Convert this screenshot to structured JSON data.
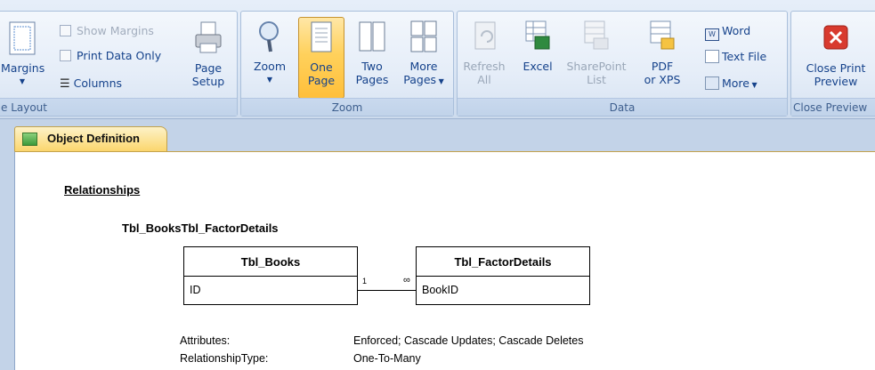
{
  "ribbon": {
    "page_layout": {
      "label": "e Layout",
      "margins": "Margins",
      "show_margins": "Show Margins",
      "print_data_only": "Print Data Only",
      "columns": "Columns",
      "page_setup_1": "Page",
      "page_setup_2": "Setup"
    },
    "zoom": {
      "label": "Zoom",
      "zoom": "Zoom",
      "one_page_1": "One",
      "one_page_2": "Page",
      "two_pages_1": "Two",
      "two_pages_2": "Pages",
      "more_pages_1": "More",
      "more_pages_2": "Pages"
    },
    "data": {
      "label": "Data",
      "refresh_1": "Refresh",
      "refresh_2": "All",
      "excel": "Excel",
      "sharepoint_1": "SharePoint",
      "sharepoint_2": "List",
      "pdf_1": "PDF",
      "pdf_2": "or XPS",
      "word": "Word",
      "text_file": "Text File",
      "more": "More"
    },
    "close": {
      "label": "Close Preview",
      "close_1": "Close Print",
      "close_2": "Preview"
    }
  },
  "document": {
    "tab_title": "Object Definition",
    "section_title": "Relationships",
    "relationship_name": "Tbl_BooksTbl_FactorDetails",
    "left_table": {
      "name": "Tbl_Books",
      "field": "ID"
    },
    "right_table": {
      "name": "Tbl_FactorDetails",
      "field": "BookID"
    },
    "one_mark": "1",
    "many_mark": "∞",
    "attributes_label": "Attributes:",
    "attributes_value": "Enforced; Cascade Updates; Cascade Deletes",
    "reltype_label": "RelationshipType:",
    "reltype_value": "One-To-Many"
  }
}
